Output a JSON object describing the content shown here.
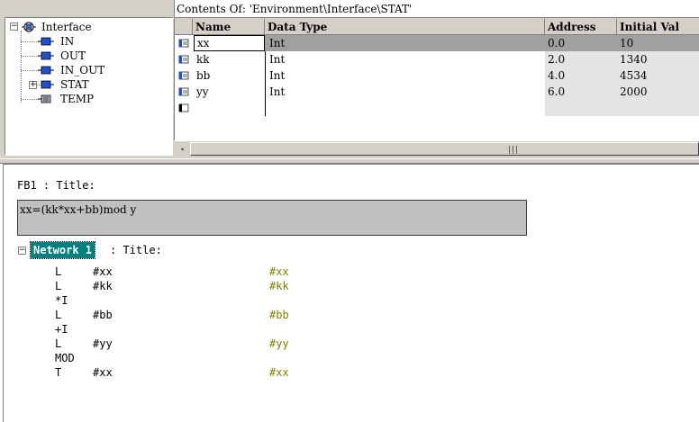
{
  "tree": {
    "root_label": "Interface",
    "items": [
      {
        "label": "IN",
        "expandable": false
      },
      {
        "label": "OUT",
        "expandable": false
      },
      {
        "label": "IN_OUT",
        "expandable": false
      },
      {
        "label": "STAT",
        "expandable": true
      },
      {
        "label": "TEMP",
        "expandable": false
      }
    ]
  },
  "contents_header": "Contents Of: 'Environment\\Interface\\STAT'",
  "grid": {
    "columns": [
      "Name",
      "Data Type",
      "Address",
      "Initial Val"
    ],
    "rows": [
      {
        "name": "xx",
        "type": "Int",
        "address": "0.0",
        "initial": "10"
      },
      {
        "name": "kk",
        "type": "Int",
        "address": "2.0",
        "initial": "1340"
      },
      {
        "name": "bb",
        "type": "Int",
        "address": "4.0",
        "initial": "4534"
      },
      {
        "name": "yy",
        "type": "Int",
        "address": "6.0",
        "initial": "2000"
      }
    ]
  },
  "scrollbar": {
    "left_arrow": "◂",
    "grip": "|||"
  },
  "editor": {
    "fb_title": "FB1 : Title:",
    "comment": "xx=(kk*xx+bb)mod y",
    "network_label": "Network 1",
    "network_title": ": Title:",
    "code": [
      {
        "op": "L",
        "operand": "#xx",
        "comment": "#xx"
      },
      {
        "op": "L",
        "operand": "#kk",
        "comment": "#kk"
      },
      {
        "op": "*I",
        "operand": "",
        "comment": ""
      },
      {
        "op": "L",
        "operand": "#bb",
        "comment": "#bb"
      },
      {
        "op": "+I",
        "operand": "",
        "comment": ""
      },
      {
        "op": "L",
        "operand": "#yy",
        "comment": "#yy"
      },
      {
        "op": "MOD",
        "operand": "",
        "comment": ""
      },
      {
        "op": "T",
        "operand": "#xx",
        "comment": "#xx"
      }
    ]
  },
  "colors": {
    "network_badge_bg": "#008080",
    "comment_bg": "#c0c0c0",
    "selected_row_bg": "#a0a0a0",
    "symbol_comment": "#808000"
  }
}
